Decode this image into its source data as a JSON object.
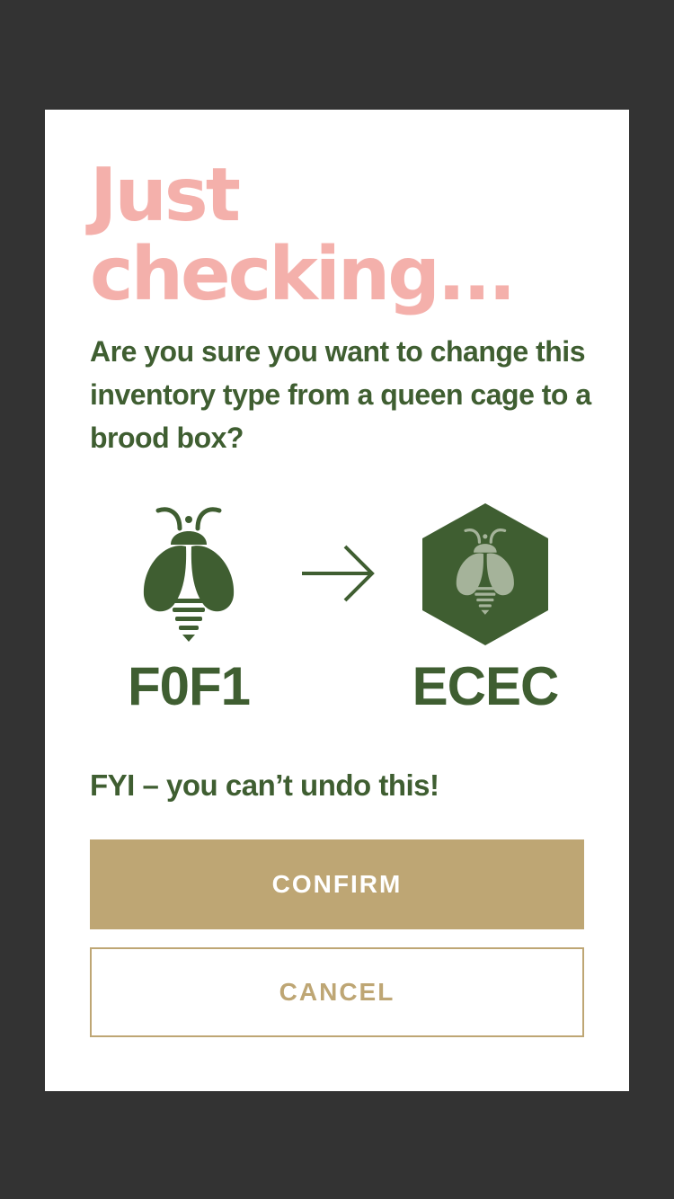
{
  "dialog": {
    "title": "Just checking...",
    "question": "Are you sure you want to change this inventory type from a queen cage to a brood box?",
    "from_code": "F0F1",
    "to_code": "ECEC",
    "from_icon": "bee-icon",
    "arrow_icon": "arrow-right-icon",
    "to_icon": "hexagon-bee-icon",
    "warning": "FYI – you can’t undo this!",
    "confirm_label": "CONFIRM",
    "cancel_label": "CANCEL"
  },
  "colors": {
    "backdrop": "#333333",
    "title": "#f4b0ab",
    "text_green": "#3f5e31",
    "accent_gold": "#bea674",
    "bee_light": "#a5b39a"
  }
}
